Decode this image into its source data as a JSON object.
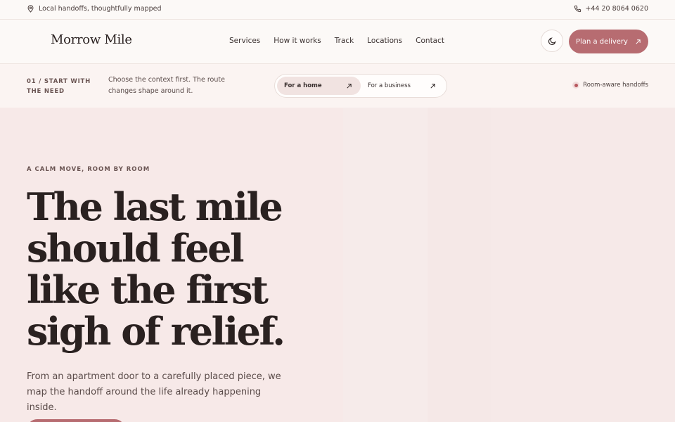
{
  "topbar": {
    "tagline": "Local handoffs, thoughtfully mapped",
    "phone": "+44 20 8064 0620",
    "tagline_icon": "map-pin-icon",
    "phone_icon": "phone-icon"
  },
  "header": {
    "brand": "Morrow Mile",
    "nav": [
      "Services",
      "How it works",
      "Track",
      "Locations",
      "Contact"
    ],
    "theme_icon": "moon-icon",
    "cta_label": "Plan a delivery",
    "cta_icon": "arrow-up-right-icon"
  },
  "context": {
    "step": "01 / START WITH THE NEED",
    "description": "Choose the context first. The route changes shape around it.",
    "options": [
      {
        "label": "For a home",
        "active": true
      },
      {
        "label": "For a business",
        "active": false
      }
    ],
    "status": "Room-aware handoffs"
  },
  "hero": {
    "eyebrow": "A CALM MOVE, ROOM BY ROOM",
    "headline_lines": [
      "The last mile",
      "should feel",
      "like the first",
      "sigh of relief."
    ],
    "lead": "From an apartment door to a carefully placed piece, we map the handoff around the life already happening inside."
  },
  "colors": {
    "accent": "#b76c71",
    "hero_bg": "#f7e9e8",
    "text": "#2a2120"
  }
}
